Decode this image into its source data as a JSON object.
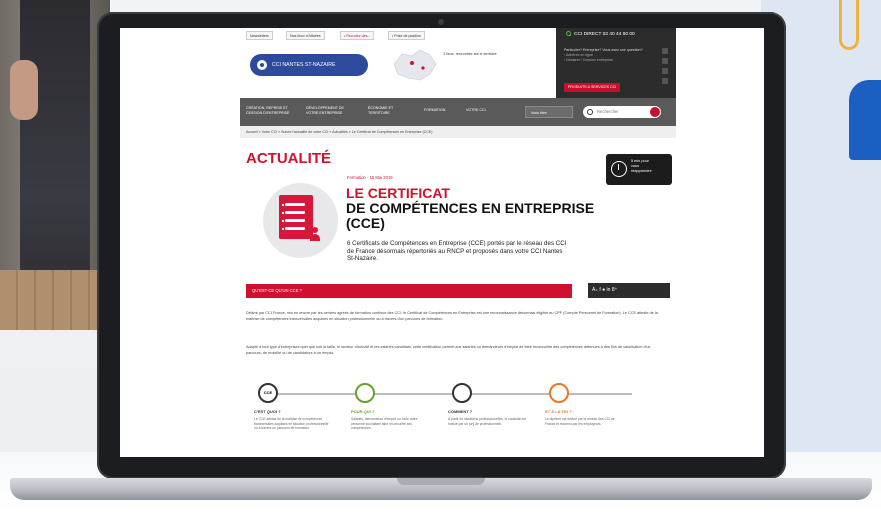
{
  "site": {
    "util_links": [
      "Newsletters",
      "Nos lieux d'Affaires",
      "• Recrutez des...",
      "• Prise de position"
    ],
    "cci_direct": "CCI DIRECT  02 40 44 60 00",
    "logo_text": "CCI NANTES ST-NAZAIRE",
    "map_text": "2 lieux, rencontrez sur le territoire",
    "promo_lines": [
      "Particulier? Entreprise? Vous avez une question?",
      "›  Adhérez en ligne",
      "›  Déclarer / Cession entreprise"
    ],
    "promo_button": "PRODUITS & SERVICES CCI",
    "nav_items": [
      "CRÉATION, REPRISE ET CESSION D'ENTREPRISE",
      "DÉVELOPPEMENT DE VOTRE ENTREPRISE",
      "ÉCONOMIE ET TERRITOIRE",
      "FORMATION",
      "VOTRE CCI"
    ],
    "nav_select": "Vous êtes",
    "search_placeholder": "Rechercher",
    "breadcrumb": "Accueil  »  Votre CCI  »  Suivre l'actualité de votre CCI  »  Actualités  »  Le Certificat de Compétences en Entreprise (CCE)"
  },
  "article": {
    "section_title": "ACTUALITÉ",
    "date": "Formation - 15 Mai 2019",
    "title_line1": "LE CERTIFICAT",
    "title_line2": "DE COMPÉTENCES EN ENTREPRISE",
    "title_line3": "(CCE)",
    "subtitle": "6 Certificats de Compétences en Entreprise (CCE) portés par le réseau des CCI de France désormais répertoriés au RNCP et proposés dans votre CCI Nantes St-Nazaire.",
    "read_time": "5 min pour\nvous\nréapprendre",
    "red_bar": "QU'EST-CE QU'UN CCE ?",
    "share_label": "A₊  f  ●  in  8⁺",
    "paragraph1": "Délivré par CCI France, mis en œuvre par les centres agréés de formation continue des CCI, le Certificat de Compétences en Entreprise est une reconnaissance désormais éligible au CPF (Compte Personnel de Formation). Le CCE atteste de la maîtrise de compétences transversales acquises en situation professionnelle ou à travers d'un parcours de formation.",
    "paragraph2": "Adapté à tout type d'entreprises quel que soit la taille, le secteur d'activité et les salariés candidats, cette certification permet aux salariés ou demandeurs d'emploi de faire reconnaître des compétences détenues à des fins de valorisation d'un parcours, de mobilité ou de candidature à un emploi."
  },
  "steps": [
    {
      "icon": "cce-icon",
      "label": "CCE",
      "title": "C'EST QUOI ?",
      "color": "#333333",
      "body": "Le CCE atteste de la maîtrise de compétences transversales acquises en situation professionnelle ou à travers un parcours de formation."
    },
    {
      "icon": "person-icon",
      "label": "",
      "title": "POUR QUI ?",
      "color": "#6a9f2f",
      "body": "Salariés, demandeurs d'emploi ou toute autre personne souhaitant faire reconnaître ses compétences."
    },
    {
      "icon": "hand-icon",
      "label": "",
      "title": "COMMENT ?",
      "color": "#333333",
      "body": "À partir de situations professionnelles, le candidat est évalué par un jury de professionnels."
    },
    {
      "icon": "runner-icon",
      "label": "",
      "title": "ET À LA FIN ?",
      "color": "#e87722",
      "body": "Le diplôme est délivré par le réseau des CCI de France et reconnu par les employeurs."
    }
  ],
  "colors": {
    "accent": "#d0102e",
    "brand_blue": "#2d4a9c",
    "nav_gray": "#5a5a5a"
  }
}
